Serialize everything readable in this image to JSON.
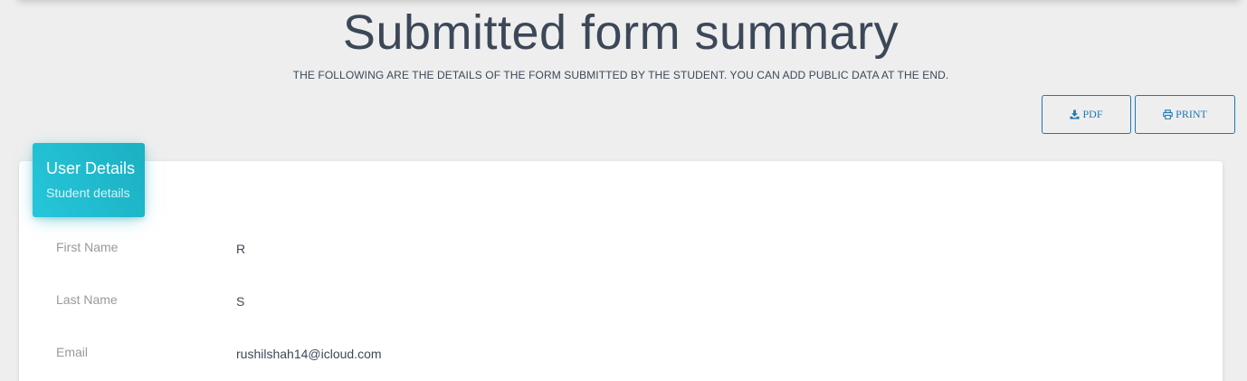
{
  "header": {
    "title": "Submitted form summary",
    "subtitle": "THE FOLLOWING ARE THE DETAILS OF THE FORM SUBMITTED BY THE STUDENT. YOU CAN ADD PUBLIC DATA AT THE END."
  },
  "actions": {
    "pdf_label": "PDF",
    "pdf_icon": "download-icon",
    "print_label": "PRINT",
    "print_icon": "printer-icon"
  },
  "card": {
    "title": "User Details",
    "subtitle": "Student details",
    "accent_color": "#26c6da",
    "fields": [
      {
        "label": "First Name",
        "value": "R"
      },
      {
        "label": "Last Name",
        "value": "S"
      },
      {
        "label": "Email",
        "value": "rushilshah14@icloud.com"
      }
    ]
  },
  "colors": {
    "background": "#eeeeee",
    "button_border": "#1f78b4",
    "text_dark": "#3c4858",
    "label_gray": "#999999"
  }
}
